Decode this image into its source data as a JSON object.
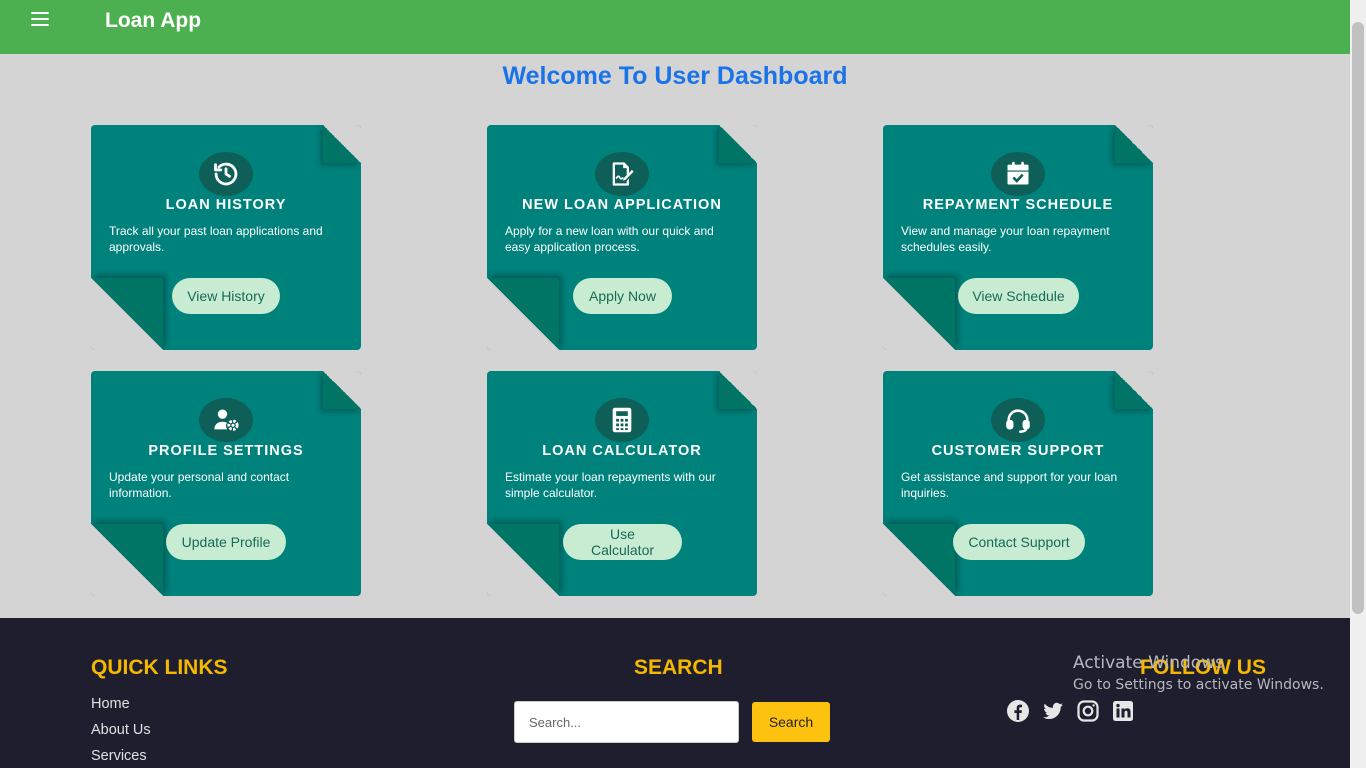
{
  "header": {
    "title": "Loan App"
  },
  "welcome": "Welcome To User Dashboard",
  "cards": [
    {
      "title": "LOAN HISTORY",
      "icon": "history-icon",
      "desc": "Track all your past loan applications and approvals.",
      "button": "View History"
    },
    {
      "title": "NEW LOAN APPLICATION",
      "icon": "file-signature-icon",
      "desc": "Apply for a new loan with our quick and easy application process.",
      "button": "Apply Now"
    },
    {
      "title": "REPAYMENT SCHEDULE",
      "icon": "calendar-check-icon",
      "desc": "View and manage your loan repayment schedules easily.",
      "button": "View Schedule"
    },
    {
      "title": "PROFILE SETTINGS",
      "icon": "user-gear-icon",
      "desc": "Update your personal and contact information.",
      "button": "Update Profile"
    },
    {
      "title": "LOAN CALCULATOR",
      "icon": "calculator-icon",
      "desc": "Estimate your loan repayments with our simple calculator.",
      "button": "Use Calculator"
    },
    {
      "title": "CUSTOMER SUPPORT",
      "icon": "headset-icon",
      "desc": "Get assistance and support for your loan inquiries.",
      "button": "Contact Support"
    }
  ],
  "footer": {
    "quick_links_title": "QUICK LINKS",
    "quick_links": [
      "Home",
      "About Us",
      "Services"
    ],
    "search_title": "SEARCH",
    "search_placeholder": "Search...",
    "search_button": "Search",
    "follow_title": "FOLLOW US",
    "social": [
      "facebook-icon",
      "twitter-icon",
      "instagram-icon",
      "linkedin-icon"
    ]
  },
  "watermark": {
    "line1": "Activate Windows",
    "line2": "Go to Settings to activate Windows."
  },
  "colors": {
    "header": "#4caf50",
    "card": "#00827c",
    "title": "#1a73e8",
    "footer": "#1f1e2e",
    "accent": "#f5b800"
  }
}
